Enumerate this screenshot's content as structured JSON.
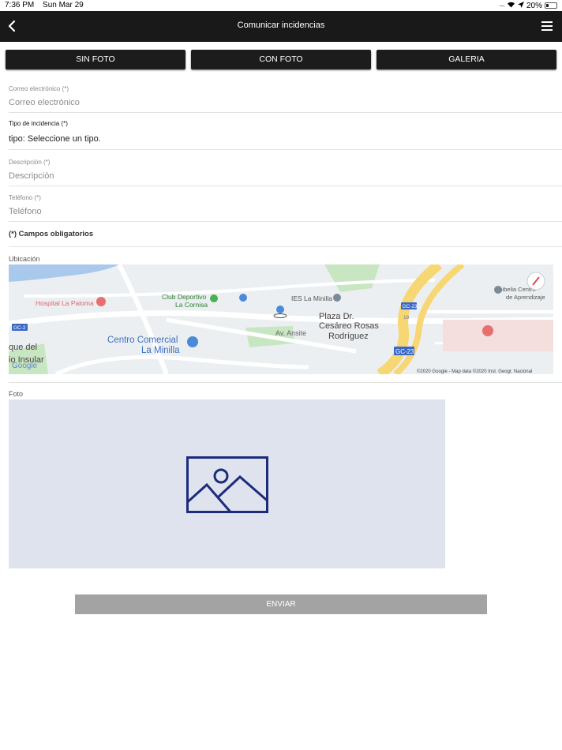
{
  "statusbar": {
    "time": "7:36 PM",
    "date": "Sun Mar 29",
    "battery": "20%"
  },
  "header": {
    "title": "Comunicar incidencias",
    "icons": [
      "chevron-left-icon",
      "hamburger-menu-icon"
    ]
  },
  "photo_buttons": {
    "sin_foto": "SIN FOTO",
    "con_foto": "CON FOTO",
    "galeria": "GALERIA"
  },
  "form": {
    "email": {
      "label": "Correo electrónico (*)",
      "placeholder": "Correo electrónico"
    },
    "type": {
      "label": "Tipo de incidencia (*)",
      "value": "tipo: Seleccione un tipo."
    },
    "description": {
      "label": "Descripción (*)",
      "placeholder": "Descripción"
    },
    "phone": {
      "label": "Teléfono (*)",
      "placeholder": "Teléfono"
    },
    "required_note": "(*) Campos obligatorios"
  },
  "location": {
    "label": "Ubicación",
    "map": {
      "labels": {
        "hospital": "Hospital La Paloma",
        "club": "Club Deportivo",
        "club2": "La Cornisa",
        "ies": "IES La Minilla",
        "unibelia": "Unibelia Centro",
        "unibelia2": "de Aprendizaje",
        "plaza": "Plaza Dr.",
        "plaza2": "Cesáreo Rosas",
        "plaza3": "Rodríguez",
        "centro": "Centro Comercial",
        "centro2": "La Minilla",
        "avenida": "Av. Ansite",
        "que": "que del",
        "insular": "io Insular",
        "gc2": "GC-2",
        "gc23a": "GC-23",
        "gc23b": "GC-23",
        "road18": "18",
        "google": "Google",
        "attribution": "©2020 Google - Map data ©2020 Inst. Geogr. Nacional"
      },
      "colors": {
        "water": "#a8c8ec",
        "park": "#c8e6c1",
        "highway": "#f7d774",
        "road": "#ffffff",
        "hospital_pin": "#e86f6f",
        "pin_blue": "#4a8ad9"
      }
    }
  },
  "photo": {
    "label": "Foto",
    "icon": "image-placeholder-icon"
  },
  "submit": {
    "label": "ENVIAR"
  }
}
